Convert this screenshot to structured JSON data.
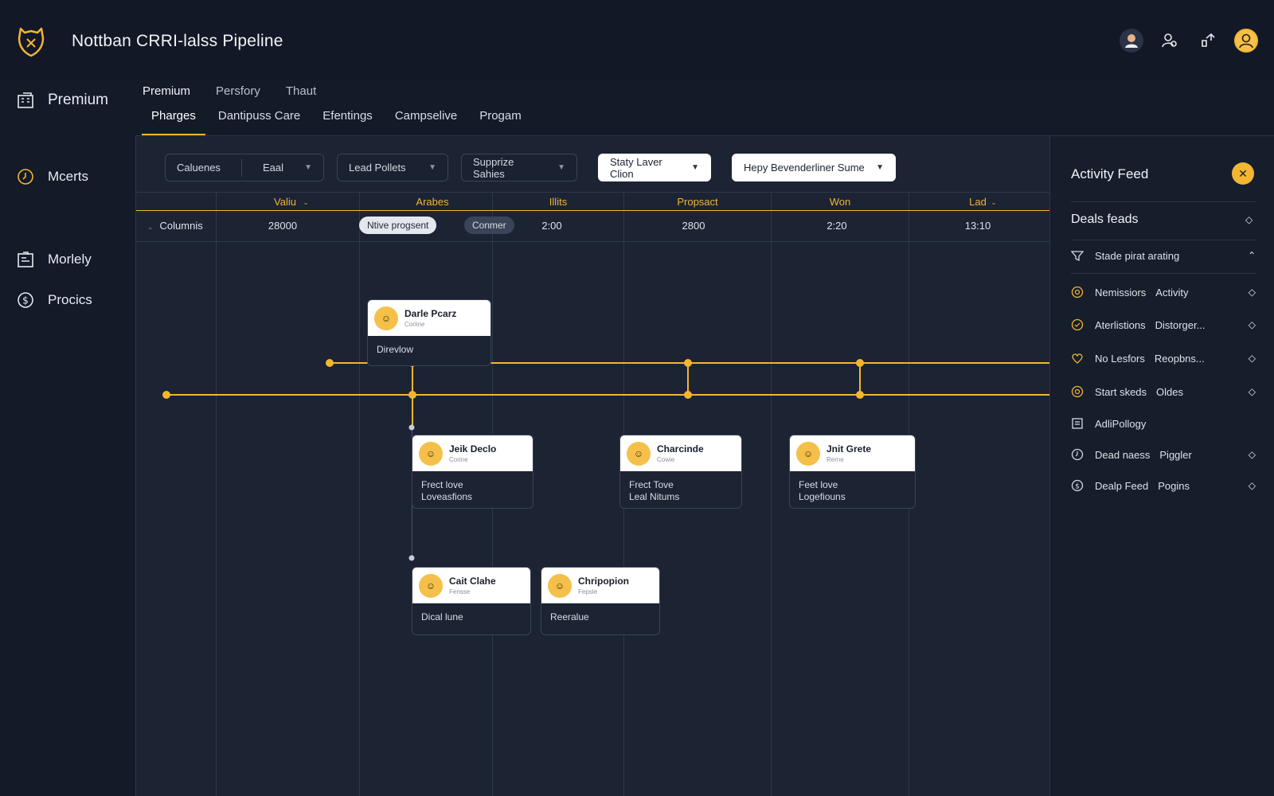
{
  "app": {
    "title": "Nottban CRRI-lalss Pipeline"
  },
  "sidebar": {
    "items": [
      {
        "label": "Premium",
        "icon": "building-icon"
      },
      {
        "label": "Mcerts",
        "icon": "clock-icon"
      },
      {
        "label": "Morlely",
        "icon": "report-icon"
      },
      {
        "label": "Procics",
        "icon": "dollar-icon"
      }
    ]
  },
  "tabs": {
    "row1": [
      "Premium",
      "Persfory",
      "Thaut"
    ],
    "row2": [
      "Pharges",
      "Dantipuss Care",
      "Efentings",
      "Campselive",
      "Progam"
    ],
    "active": "Pharges"
  },
  "filters": {
    "first_a": "Caluenes",
    "first_b": "Eaal",
    "lead": "Lead Pollets",
    "supprize": "Supprize Sahies",
    "staty": "Staty Laver Clion",
    "hepy": "Hepy Bevenderliner Sume"
  },
  "columns": {
    "headers": [
      "Valiu",
      "Arabes",
      "Illits",
      "Propsact",
      "Won",
      "Lad"
    ],
    "row_label": "Columnis",
    "values": [
      "28000",
      "2:00",
      "2800",
      "2:20",
      "13:10"
    ],
    "pill_light": "Ntive progsent",
    "pill_dark": "Conmer"
  },
  "cards": [
    {
      "name": "Darle Pcarz",
      "sub": "Coriine",
      "body1": "Direvlow",
      "body2": ""
    },
    {
      "name": "Jeik Declo",
      "sub": "Corine",
      "body1": "Frect love",
      "body2": "Loveasfions"
    },
    {
      "name": "Charcinde",
      "sub": "Cowie",
      "body1": "Frect Tove",
      "body2": "Leal Nitums"
    },
    {
      "name": "Jnit Grete",
      "sub": "Rerne",
      "body1": "Feet love",
      "body2": "Logefiouns"
    },
    {
      "name": "Cait Clahe",
      "sub": "Fensse",
      "body1": "Dical lune",
      "body2": ""
    },
    {
      "name": "Chripopion",
      "sub": "Fepsle",
      "body1": "Reeralue",
      "body2": ""
    }
  ],
  "activity": {
    "title": "Activity Feed",
    "section": "Deals feads",
    "rows": [
      {
        "a": "Stade pirat arating",
        "b": "",
        "icon": "filter-icon",
        "right": "caret-up-icon"
      },
      {
        "a": "Nemissiors",
        "b": "Activity",
        "icon": "coin-icon",
        "right": "diamond-icon"
      },
      {
        "a": "Aterlistions",
        "b": "Distorger...",
        "icon": "badge-icon",
        "right": "diamond-icon"
      },
      {
        "a": "No Lesfors",
        "b": "Reopbns...",
        "icon": "heart-icon",
        "right": "diamond-icon"
      },
      {
        "a": "Start skeds",
        "b": "Oldes",
        "icon": "coin-icon",
        "right": "diamond-icon"
      },
      {
        "a": "AdliPollogy",
        "b": "",
        "icon": "list-icon",
        "right": ""
      },
      {
        "a": "Dead naess",
        "b": "Piggler",
        "icon": "clock-icon",
        "right": "diamond-icon"
      },
      {
        "a": "Dealp Feed",
        "b": "Pogins",
        "icon": "dollar-icon",
        "right": "diamond-icon"
      }
    ]
  },
  "colors": {
    "accent": "#f2b632",
    "background": "#131a28",
    "board": "#1c2333"
  }
}
